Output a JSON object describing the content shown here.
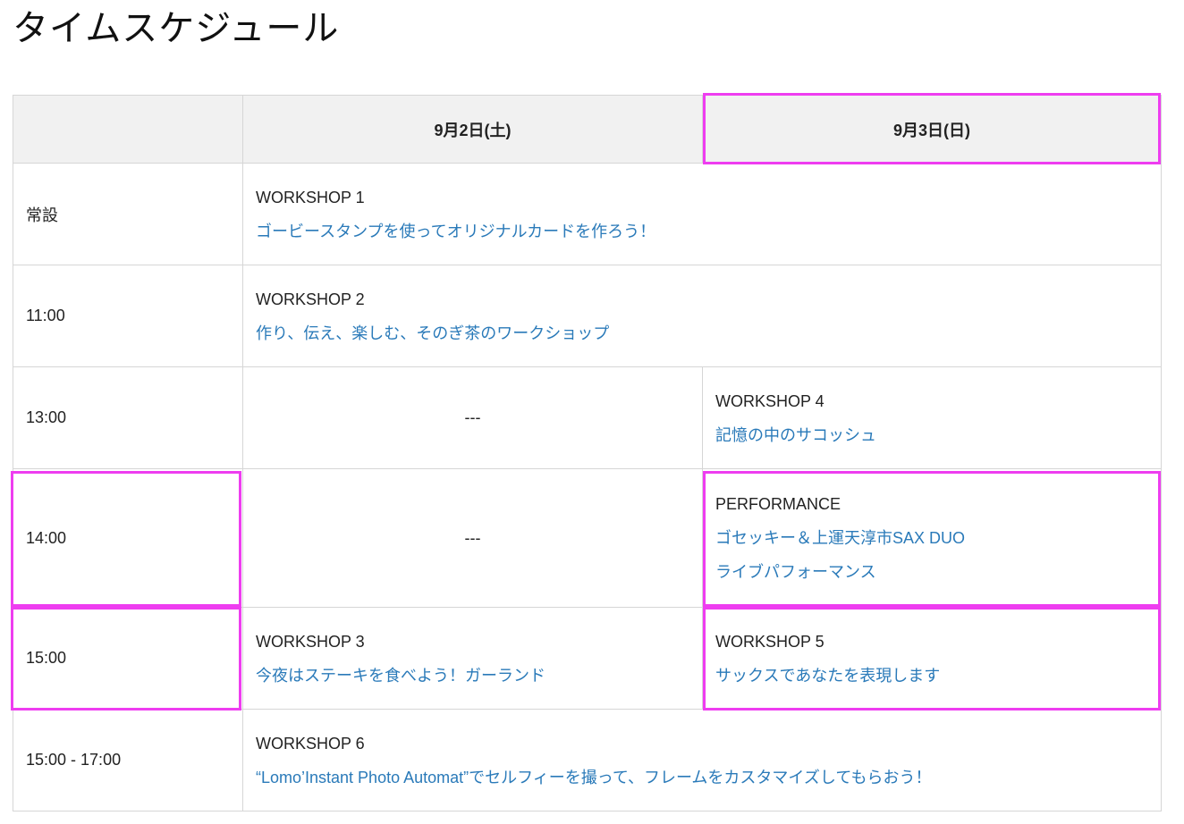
{
  "page": {
    "title": "タイムスケジュール"
  },
  "header": {
    "time_col": "",
    "day1": "9月2日(土)",
    "day2": "9月3日(日)"
  },
  "rows": [
    {
      "time": "常設",
      "category": "WORKSHOP 1",
      "title": "ゴービースタンプを使ってオリジナルカードを作ろう！"
    },
    {
      "time": "11:00",
      "category": "WORKSHOP 2",
      "title": "作り、伝え、楽しむ、そのぎ茶のワークショップ"
    },
    {
      "time": "13:00",
      "day1": "---",
      "day2_category": "WORKSHOP 4",
      "day2_title": "記憶の中のサコッシュ"
    },
    {
      "time": "14:00",
      "day1": "---",
      "day2_category": "PERFORMANCE",
      "day2_title_line1": "ゴセッキー＆上運天淳市SAX DUO",
      "day2_title_line2": "ライブパフォーマンス"
    },
    {
      "time": "15:00",
      "day1_category": "WORKSHOP 3",
      "day1_title": "今夜はステーキを食べよう！ガーランド",
      "day2_category": "WORKSHOP 5",
      "day2_title": "サックスであなたを表現します"
    },
    {
      "time": "15:00 - 17:00",
      "category": "WORKSHOP 6",
      "title": "“Lomo’Instant Photo Automat”でセルフィーを撮って、フレームをカスタマイズしてもらおう！"
    }
  ],
  "colors": {
    "link": "#2a7ab9",
    "highlight": "#ee3df0",
    "header_bg": "#f1f1f1",
    "border": "#d6d6d6"
  }
}
